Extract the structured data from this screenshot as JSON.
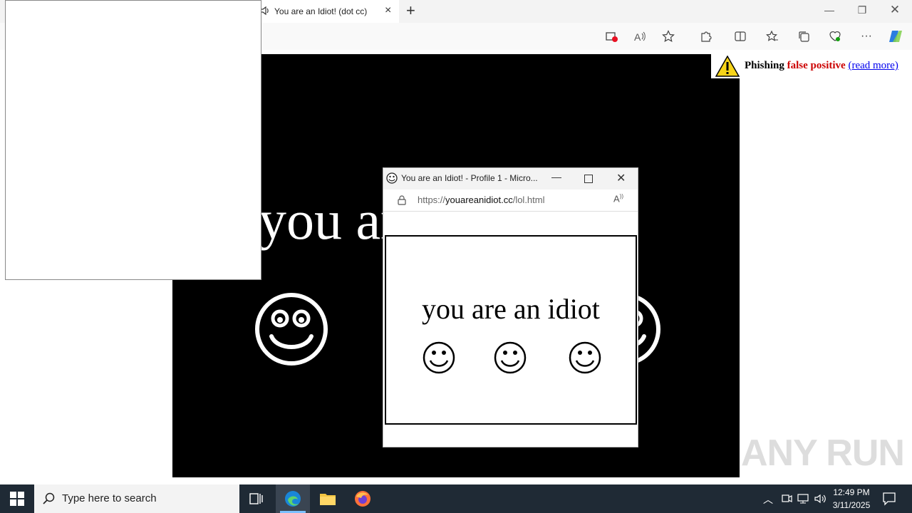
{
  "browser": {
    "tab_title": "You are an Idiot! (dot cc)",
    "tab_audio_icon": "speaker-icon",
    "new_tab_label": "+",
    "window_controls": [
      "minimize-icon",
      "restore-icon",
      "close-icon"
    ],
    "toolbar_icons": [
      "tracking-blocked-icon",
      "read-aloud-icon",
      "add-favorite-icon",
      "extensions-icon",
      "split-screen-icon",
      "favorites-icon",
      "collections-icon",
      "browser-essentials-icon",
      "more-icon",
      "copilot-icon"
    ]
  },
  "page": {
    "headline": "you are an idiot",
    "background": "#000000",
    "text_color": "#ffffff"
  },
  "warning_banner": {
    "icon": "warning-triangle-icon",
    "prefix": "Phishing",
    "highlight": "false positive",
    "link": "(read more)",
    "highlight_color": "#cc0000"
  },
  "popup": {
    "icon": "smiley-icon",
    "title": "You are an Idiot! - Profile 1 - Micro...",
    "address_prefix": "https://",
    "address_host": "youareanidiot.cc",
    "address_path": "/lol.html",
    "headline": "you are an idiot"
  },
  "taskbar": {
    "search_placeholder": "Type here to search",
    "time": "12:49 PM",
    "date": "3/11/2025",
    "apps": [
      "task-view-icon",
      "edge-icon",
      "file-explorer-icon",
      "firefox-icon"
    ],
    "tray_icons": [
      "chevron-up-icon",
      "meet-now-icon",
      "network-icon",
      "volume-icon",
      "notifications-icon"
    ]
  },
  "watermark": "ANY RUN"
}
